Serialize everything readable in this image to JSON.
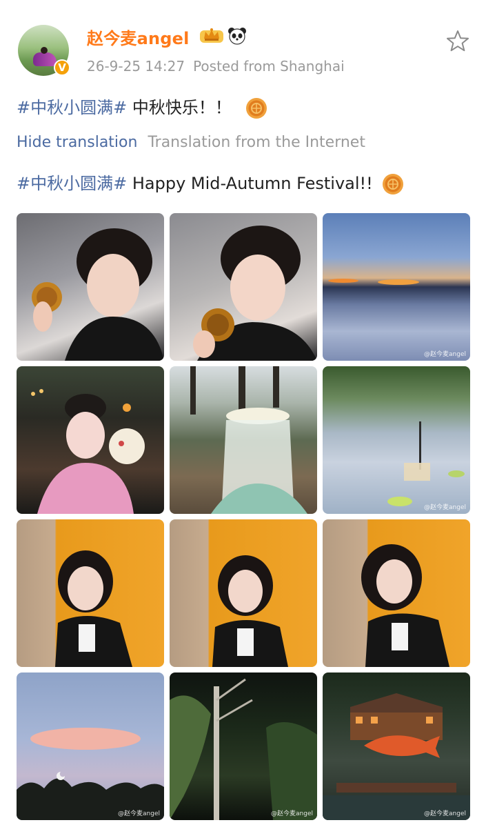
{
  "post": {
    "username": "赵今麦angel",
    "timestamp": "26-9-25 14:27",
    "location": "Posted from Shanghai",
    "text_original_tag": "#中秋小圆满#",
    "text_original_body": "中秋快乐！！",
    "translation_toggle": "Hide translation",
    "translation_source": "Translation from the Internet",
    "text_translated_tag": "#中秋小圆满#",
    "text_translated_body": "Happy Mid-Autumn Festival!!"
  },
  "icons": {
    "avatar": "avatar",
    "verified": "verified-badge-icon",
    "crown": "crown-badge-icon",
    "panda": "panda-icon",
    "favorite": "star-icon",
    "mooncake": "mooncake-emoji-icon"
  },
  "photo_watermark": "@赵今麦angel",
  "colors": {
    "username": "#ff7a1a",
    "link": "#4b6aa1",
    "meta": "#9a9a9a",
    "verified": "#f5a10a"
  }
}
